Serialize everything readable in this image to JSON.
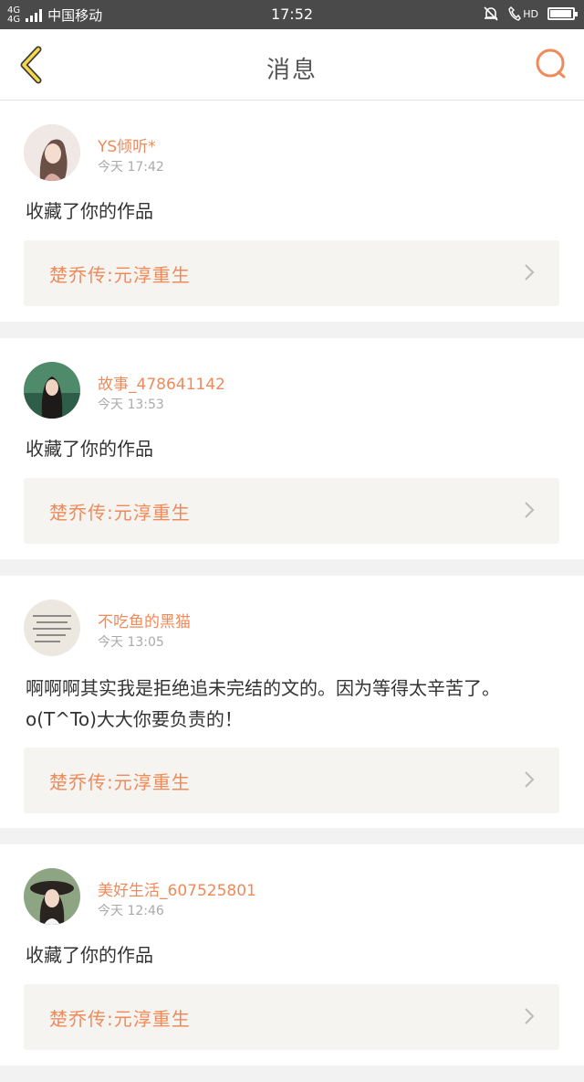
{
  "status_bar": {
    "network": "4G",
    "network2": "4G",
    "carrier": "中国移动",
    "time": "17:52",
    "hd": "HD",
    "battery_level": 0.95
  },
  "header": {
    "title": "消息",
    "back_icon": "chevron-left-icon",
    "search_icon": "search-icon",
    "accent_color": "#ef8a5a"
  },
  "messages": [
    {
      "username": "YS倾听*",
      "time": "今天 17:42",
      "text": "收藏了你的作品",
      "ref_title": "楚乔传:元淳重生"
    },
    {
      "username": "故事_478641142",
      "time": "今天 13:53",
      "text": "收藏了你的作品",
      "ref_title": "楚乔传:元淳重生"
    },
    {
      "username": "不吃鱼的黑猫",
      "time": "今天 13:05",
      "text": "啊啊啊其实我是拒绝追未完结的文的。因为等得太辛苦了。o(T^To)大大你要负责的！",
      "ref_title": "楚乔传:元淳重生"
    },
    {
      "username": "美好生活_607525801",
      "time": "今天 12:46",
      "text": "收藏了你的作品",
      "ref_title": "楚乔传:元淳重生"
    }
  ]
}
